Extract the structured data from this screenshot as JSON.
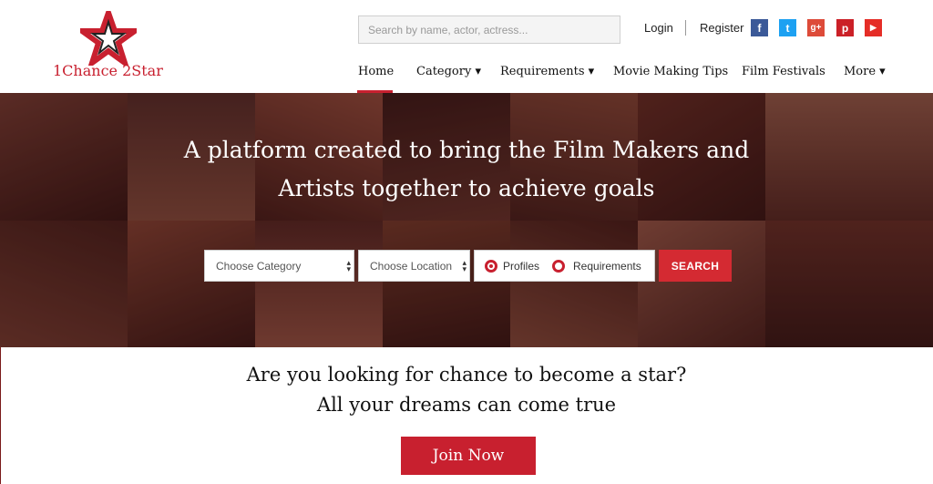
{
  "logo": {
    "text": "1Chance 2Star"
  },
  "search": {
    "placeholder": "Search by name, actor, actress..."
  },
  "top_links": {
    "login": "Login",
    "register": "Register"
  },
  "social": [
    {
      "name": "facebook-icon",
      "glyph": "f",
      "color": "#3b5998"
    },
    {
      "name": "twitter-icon",
      "glyph": "t",
      "color": "#1da1f2"
    },
    {
      "name": "google-plus-icon",
      "glyph": "g+",
      "color": "#dd4b39"
    },
    {
      "name": "pinterest-icon",
      "glyph": "p",
      "color": "#cb2027"
    },
    {
      "name": "youtube-icon",
      "glyph": "▶",
      "color": "#e52d27"
    }
  ],
  "nav": {
    "home": "Home",
    "category": "Category ▾",
    "requirements": "Requirements ▾",
    "tips": "Movie Making Tips",
    "festivals": "Film Festivals",
    "more": "More ▾"
  },
  "hero": {
    "title_line1": "A platform created to bring the Film Makers and",
    "title_line2": "Artists together to achieve goals",
    "category_select": "Choose Category",
    "location_select": "Choose Location",
    "radio_profiles": "Profiles",
    "radio_requirements": "Requirements",
    "search_button": "SEARCH"
  },
  "tagline": {
    "line1": "Are you looking for chance to become a star?",
    "line2": "All your dreams can come true"
  },
  "join_button": "Join Now"
}
